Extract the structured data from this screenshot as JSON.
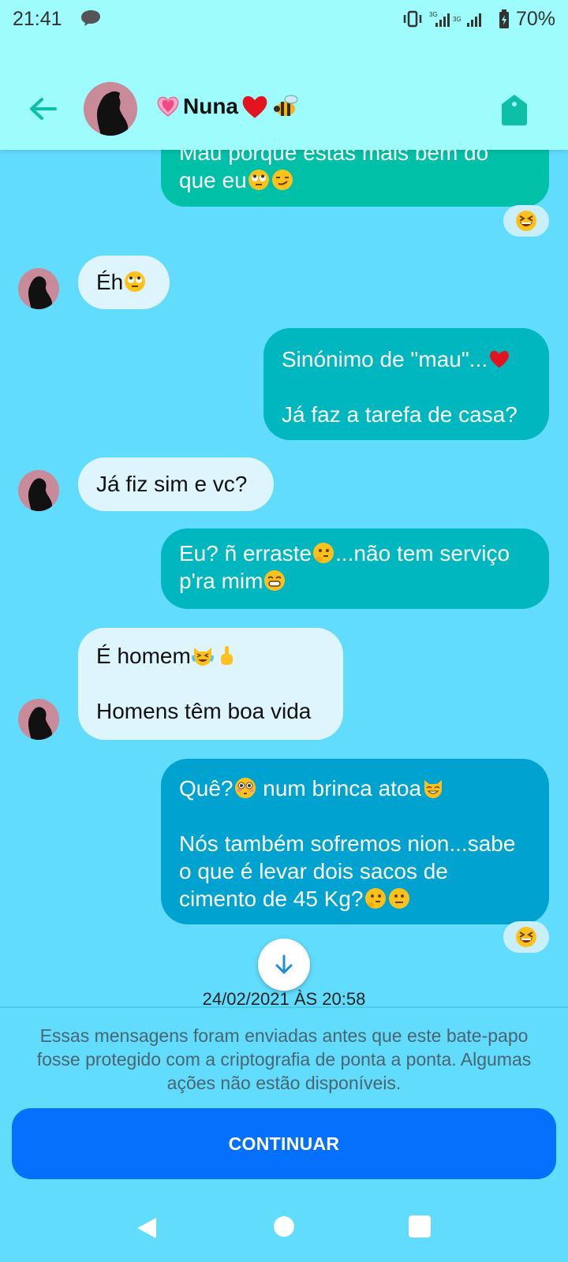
{
  "status_bar": {
    "time": "21:41",
    "network_1": "3G",
    "network_2": "3G",
    "battery": "70%",
    "icons": [
      "chat-notification-icon",
      "vibrate-icon",
      "signal-icon",
      "battery-icon"
    ]
  },
  "header": {
    "contact_name": "Nuna",
    "icons": [
      "back-arrow-icon",
      "tag-icon"
    ]
  },
  "messages": [
    {
      "direction": "out",
      "text": "Mau porque estas mais bem do que eu",
      "emojis": [
        "face-rolling-eyes",
        "smirking-face"
      ],
      "reaction": "grinning-squinting-face"
    },
    {
      "direction": "in",
      "text": "Éh",
      "emojis": [
        "face-rolling-eyes"
      ]
    },
    {
      "direction": "out",
      "line1": "Sinónimo de \"mau\"...",
      "line2": "Já faz a tarefa de casa?",
      "emojis": [
        "red-heart"
      ]
    },
    {
      "direction": "in",
      "text": "Já fiz sim e vc?"
    },
    {
      "direction": "out",
      "part1": "Eu? ñ erraste",
      "part2": "...não tem serviço p'ra mim",
      "emojis": [
        "thinking-face",
        "beaming-face"
      ]
    },
    {
      "direction": "in",
      "line1": "É homem",
      "line2": "Homens têm boa vida",
      "emojis": [
        "cat-tears-of-joy",
        "middle-finger"
      ]
    },
    {
      "direction": "out",
      "part1": "Quê?",
      "part2": " num brinca atoa",
      "line2": "Nós também sofremos nion...sabe o que é levar dois sacos de cimento de 45 Kg?",
      "emojis": [
        "flushed-face",
        "grinning-cat",
        "thinking-face",
        "neutral-face"
      ],
      "reaction": "grinning-squinting-face"
    }
  ],
  "date_stamp": "24/02/2021 ÀS 20:58",
  "notice": "Essas mensagens foram enviadas antes que este bate-papo fosse protegido com a criptografia de ponta a ponta. Algumas ações não estão disponíveis.",
  "continue_label": "CONTINUAR",
  "nav": [
    "back-triangle-icon",
    "home-circle-icon",
    "recents-square-icon"
  ],
  "colors": {
    "background": "#62dcfd",
    "header": "#9efcfd",
    "accent": "#00c1a7",
    "button": "#0570fb"
  }
}
